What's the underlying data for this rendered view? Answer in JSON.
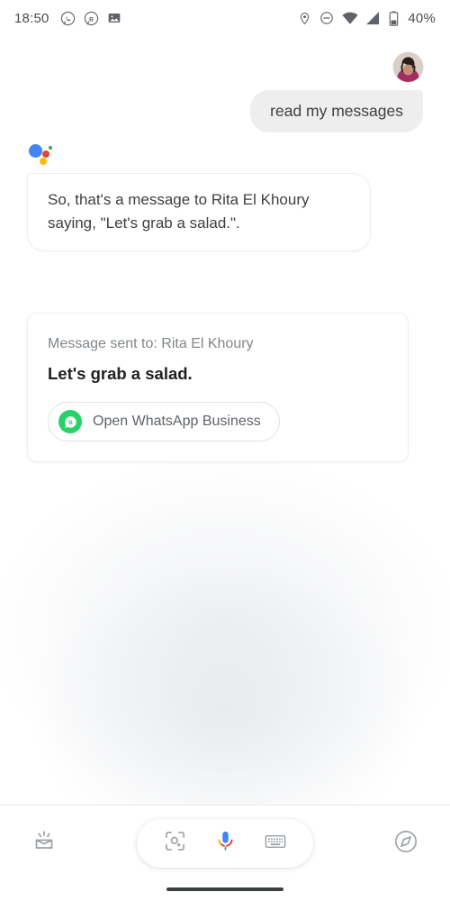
{
  "status_bar": {
    "time": "18:50",
    "battery_percent": "40%",
    "left_icons": [
      "whatsapp-icon",
      "whatsapp-business-icon",
      "photo-icon"
    ],
    "right_icons": [
      "location-icon",
      "do-not-disturb-icon",
      "wifi-icon",
      "cellular-signal-icon",
      "battery-icon"
    ]
  },
  "conversation": {
    "user_turn": {
      "avatar": "user-avatar",
      "text": "read my messages"
    },
    "assistant_turn": {
      "logo": "google-assistant-logo",
      "text": "So, that's a message to Rita El Khoury saying, \"Let's grab a salad.\"."
    },
    "result_card": {
      "label": "Message sent to: Rita El Khoury",
      "message": "Let's grab a salad.",
      "action_label": "Open WhatsApp Business",
      "action_icon": "whatsapp-business-icon"
    }
  },
  "bottom_bar": {
    "snapshot_icon": "snapshot-icon",
    "lens_icon": "google-lens-icon",
    "mic_icon": "google-mic-icon",
    "keyboard_icon": "keyboard-icon",
    "explore_icon": "explore-compass-icon"
  },
  "colors": {
    "google_blue": "#4285f4",
    "google_red": "#ea4335",
    "google_yellow": "#fbbc04",
    "google_green": "#34a853",
    "whatsapp_green": "#25d366",
    "user_bubble_bg": "#eeeeee",
    "text_primary": "#202124",
    "text_secondary": "#5f6368",
    "text_muted": "#80868b"
  }
}
